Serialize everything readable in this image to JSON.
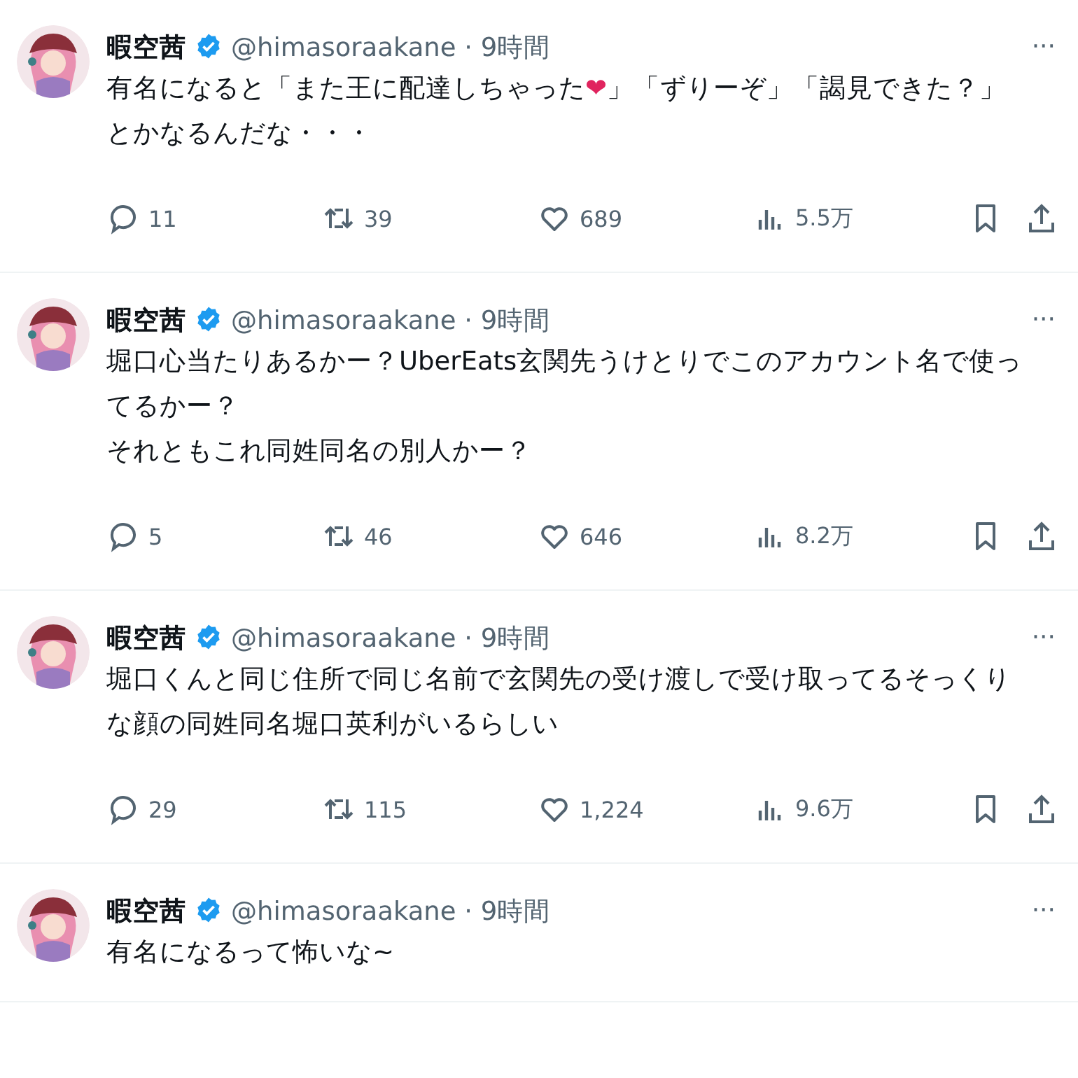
{
  "tweets": [
    {
      "author": "暇空茜",
      "verified": true,
      "handle": "@himasoraakane",
      "separator": "·",
      "time": "9時間",
      "more": "···",
      "body": [
        {
          "kind": "text",
          "text": "有名になると「また王に配達しちゃった"
        },
        {
          "kind": "emoji",
          "text": "❤"
        },
        {
          "kind": "text",
          "text": "」「ずりーぞ」「謁見できた？」とかなるんだな・・・"
        }
      ],
      "stats": {
        "replies": "11",
        "retweets": "39",
        "likes": "689",
        "views": "5.5万"
      }
    },
    {
      "author": "暇空茜",
      "verified": true,
      "handle": "@himasoraakane",
      "separator": "·",
      "time": "9時間",
      "more": "···",
      "body": [
        {
          "kind": "text",
          "text": "堀口心当たりあるかー？UberEats玄関先うけとりでこのアカウント名で使ってるかー？"
        },
        {
          "kind": "break"
        },
        {
          "kind": "text",
          "text": "それともこれ同姓同名の別人かー？"
        }
      ],
      "stats": {
        "replies": "5",
        "retweets": "46",
        "likes": "646",
        "views": "8.2万"
      }
    },
    {
      "author": "暇空茜",
      "verified": true,
      "handle": "@himasoraakane",
      "separator": "·",
      "time": "9時間",
      "more": "···",
      "body": [
        {
          "kind": "text",
          "text": "堀口くんと同じ住所で同じ名前で玄関先の受け渡しで受け取ってるそっくりな顔の同姓同名堀口英利がいるらしい"
        }
      ],
      "stats": {
        "replies": "29",
        "retweets": "115",
        "likes": "1,224",
        "views": "9.6万"
      }
    },
    {
      "author": "暇空茜",
      "verified": true,
      "handle": "@himasoraakane",
      "separator": "·",
      "time": "9時間",
      "more": "···",
      "body": [
        {
          "kind": "text",
          "text": "有名になるって怖いな~"
        }
      ]
    }
  ]
}
